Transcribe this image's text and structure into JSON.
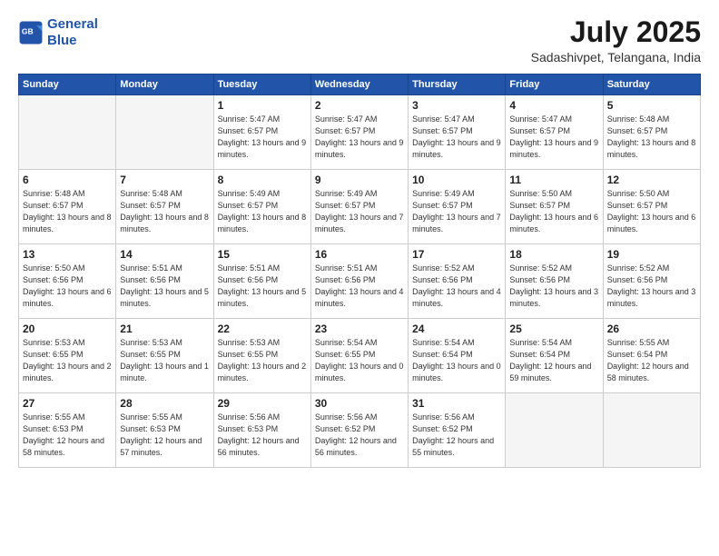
{
  "logo": {
    "line1": "General",
    "line2": "Blue"
  },
  "title": "July 2025",
  "location": "Sadashivpet, Telangana, India",
  "days_header": [
    "Sunday",
    "Monday",
    "Tuesday",
    "Wednesday",
    "Thursday",
    "Friday",
    "Saturday"
  ],
  "weeks": [
    [
      {
        "day": "",
        "info": ""
      },
      {
        "day": "",
        "info": ""
      },
      {
        "day": "1",
        "info": "Sunrise: 5:47 AM\nSunset: 6:57 PM\nDaylight: 13 hours\nand 9 minutes."
      },
      {
        "day": "2",
        "info": "Sunrise: 5:47 AM\nSunset: 6:57 PM\nDaylight: 13 hours\nand 9 minutes."
      },
      {
        "day": "3",
        "info": "Sunrise: 5:47 AM\nSunset: 6:57 PM\nDaylight: 13 hours\nand 9 minutes."
      },
      {
        "day": "4",
        "info": "Sunrise: 5:47 AM\nSunset: 6:57 PM\nDaylight: 13 hours\nand 9 minutes."
      },
      {
        "day": "5",
        "info": "Sunrise: 5:48 AM\nSunset: 6:57 PM\nDaylight: 13 hours\nand 8 minutes."
      }
    ],
    [
      {
        "day": "6",
        "info": "Sunrise: 5:48 AM\nSunset: 6:57 PM\nDaylight: 13 hours\nand 8 minutes."
      },
      {
        "day": "7",
        "info": "Sunrise: 5:48 AM\nSunset: 6:57 PM\nDaylight: 13 hours\nand 8 minutes."
      },
      {
        "day": "8",
        "info": "Sunrise: 5:49 AM\nSunset: 6:57 PM\nDaylight: 13 hours\nand 8 minutes."
      },
      {
        "day": "9",
        "info": "Sunrise: 5:49 AM\nSunset: 6:57 PM\nDaylight: 13 hours\nand 7 minutes."
      },
      {
        "day": "10",
        "info": "Sunrise: 5:49 AM\nSunset: 6:57 PM\nDaylight: 13 hours\nand 7 minutes."
      },
      {
        "day": "11",
        "info": "Sunrise: 5:50 AM\nSunset: 6:57 PM\nDaylight: 13 hours\nand 6 minutes."
      },
      {
        "day": "12",
        "info": "Sunrise: 5:50 AM\nSunset: 6:57 PM\nDaylight: 13 hours\nand 6 minutes."
      }
    ],
    [
      {
        "day": "13",
        "info": "Sunrise: 5:50 AM\nSunset: 6:56 PM\nDaylight: 13 hours\nand 6 minutes."
      },
      {
        "day": "14",
        "info": "Sunrise: 5:51 AM\nSunset: 6:56 PM\nDaylight: 13 hours\nand 5 minutes."
      },
      {
        "day": "15",
        "info": "Sunrise: 5:51 AM\nSunset: 6:56 PM\nDaylight: 13 hours\nand 5 minutes."
      },
      {
        "day": "16",
        "info": "Sunrise: 5:51 AM\nSunset: 6:56 PM\nDaylight: 13 hours\nand 4 minutes."
      },
      {
        "day": "17",
        "info": "Sunrise: 5:52 AM\nSunset: 6:56 PM\nDaylight: 13 hours\nand 4 minutes."
      },
      {
        "day": "18",
        "info": "Sunrise: 5:52 AM\nSunset: 6:56 PM\nDaylight: 13 hours\nand 3 minutes."
      },
      {
        "day": "19",
        "info": "Sunrise: 5:52 AM\nSunset: 6:56 PM\nDaylight: 13 hours\nand 3 minutes."
      }
    ],
    [
      {
        "day": "20",
        "info": "Sunrise: 5:53 AM\nSunset: 6:55 PM\nDaylight: 13 hours\nand 2 minutes."
      },
      {
        "day": "21",
        "info": "Sunrise: 5:53 AM\nSunset: 6:55 PM\nDaylight: 13 hours\nand 1 minute."
      },
      {
        "day": "22",
        "info": "Sunrise: 5:53 AM\nSunset: 6:55 PM\nDaylight: 13 hours\nand 2 minutes."
      },
      {
        "day": "23",
        "info": "Sunrise: 5:54 AM\nSunset: 6:55 PM\nDaylight: 13 hours\nand 0 minutes."
      },
      {
        "day": "24",
        "info": "Sunrise: 5:54 AM\nSunset: 6:54 PM\nDaylight: 13 hours\nand 0 minutes."
      },
      {
        "day": "25",
        "info": "Sunrise: 5:54 AM\nSunset: 6:54 PM\nDaylight: 12 hours\nand 59 minutes."
      },
      {
        "day": "26",
        "info": "Sunrise: 5:55 AM\nSunset: 6:54 PM\nDaylight: 12 hours\nand 58 minutes."
      }
    ],
    [
      {
        "day": "27",
        "info": "Sunrise: 5:55 AM\nSunset: 6:53 PM\nDaylight: 12 hours\nand 58 minutes."
      },
      {
        "day": "28",
        "info": "Sunrise: 5:55 AM\nSunset: 6:53 PM\nDaylight: 12 hours\nand 57 minutes."
      },
      {
        "day": "29",
        "info": "Sunrise: 5:56 AM\nSunset: 6:53 PM\nDaylight: 12 hours\nand 56 minutes."
      },
      {
        "day": "30",
        "info": "Sunrise: 5:56 AM\nSunset: 6:52 PM\nDaylight: 12 hours\nand 56 minutes."
      },
      {
        "day": "31",
        "info": "Sunrise: 5:56 AM\nSunset: 6:52 PM\nDaylight: 12 hours\nand 55 minutes."
      },
      {
        "day": "",
        "info": ""
      },
      {
        "day": "",
        "info": ""
      }
    ]
  ]
}
